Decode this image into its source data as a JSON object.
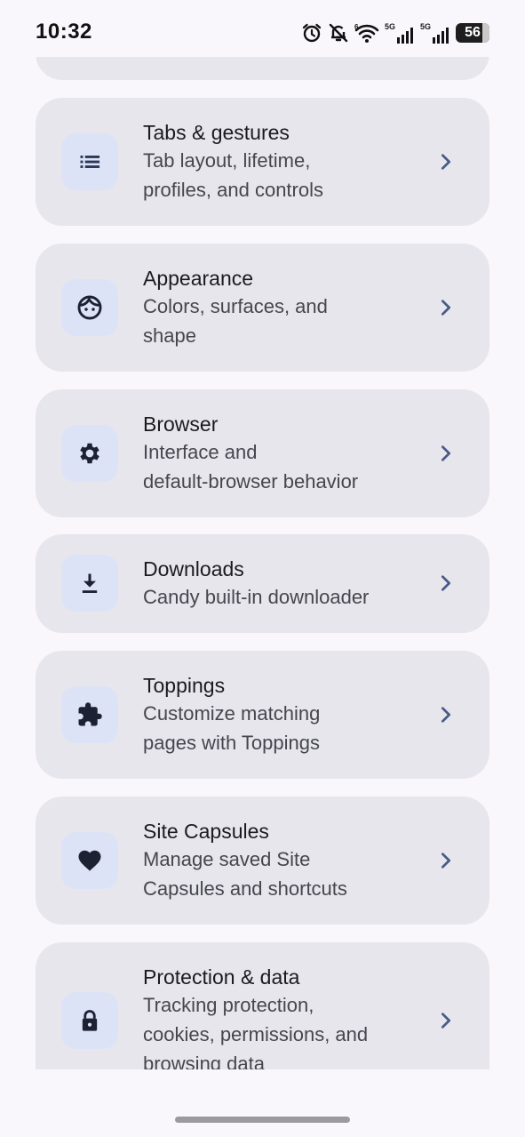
{
  "status_bar": {
    "time": "10:32",
    "network_1": "5G",
    "network_2": "5G",
    "battery": "56"
  },
  "settings": [
    {
      "title": "Tabs & gestures",
      "subtitle_lines": [
        "Tab layout, lifetime,",
        "profiles, and controls"
      ],
      "icon": "list-icon"
    },
    {
      "title": "Appearance",
      "subtitle_lines": [
        "Colors, surfaces, and",
        "shape"
      ],
      "icon": "face-icon"
    },
    {
      "title": "Browser",
      "subtitle_lines": [
        "Interface and",
        "default-browser behavior"
      ],
      "icon": "gear-icon"
    },
    {
      "title": "Downloads",
      "subtitle_lines": [
        "Candy built-in downloader"
      ],
      "icon": "download-icon"
    },
    {
      "title": "Toppings",
      "subtitle_lines": [
        "Customize matching",
        "pages with Toppings"
      ],
      "icon": "puzzle-icon"
    },
    {
      "title": "Site Capsules",
      "subtitle_lines": [
        "Manage saved Site",
        "Capsules and shortcuts"
      ],
      "icon": "heart-icon"
    },
    {
      "title": "Protection & data",
      "subtitle_lines": [
        "Tracking protection,",
        "cookies, permissions, and",
        "browsing data"
      ],
      "icon": "lock-icon"
    }
  ]
}
